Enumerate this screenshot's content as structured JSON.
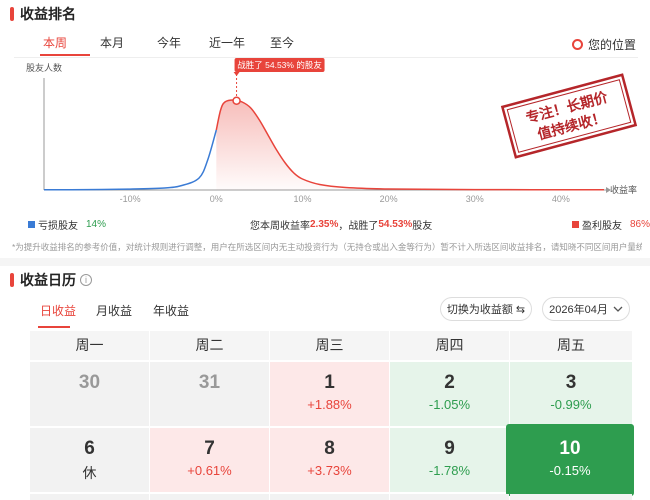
{
  "rank_section": {
    "title": "收益排名",
    "tabs": [
      "本周",
      "本月",
      "今年",
      "近一年",
      "至今"
    ],
    "active_tab": "本周",
    "my_position_label": "您的位置",
    "tooltip": "战胜了 54.53% 的股友",
    "y_axis_label": "股友人数",
    "x_axis_label": "收益率",
    "x_ticks": [
      "-10%",
      "0%",
      "10%",
      "20%",
      "30%",
      "40%"
    ],
    "stamp_line1": "专注！长期价",
    "stamp_line2": "值持续收！",
    "legend_loss_label": "亏损股友",
    "legend_loss_pct": "14%",
    "legend_profit_label": "盈利股友",
    "legend_profit_pct": "86%",
    "summary_prefix": "您本周收益率",
    "summary_rate": "2.35%",
    "summary_mid": "，战胜了",
    "summary_beat": "54.53%",
    "summary_suffix": "股友",
    "note": "*为提升收益排名的参考价值，对统计规则进行调整，用户在所选区间内无主动投资行为（无持仓或出入金等行为）暂不计入所选区间收益排名，请知晓不同区间用户量统计基数差异。",
    "colors": {
      "loss": "#3a7bd5",
      "profit": "#e8443b"
    }
  },
  "chart_data": {
    "type": "area",
    "xlabel": "收益率",
    "ylabel": "股友人数",
    "x_ticks": [
      "-10%",
      "0%",
      "10%",
      "20%",
      "30%",
      "40%"
    ],
    "xlim": [
      -20,
      45
    ],
    "series": [
      {
        "name": "亏损股友",
        "x": [
          -20,
          -15,
          -10,
          -6,
          -4,
          -2,
          -1,
          0
        ],
        "y": [
          0.2,
          0.4,
          0.9,
          2,
          4.5,
          12,
          30,
          60
        ]
      },
      {
        "name": "盈利股友",
        "x": [
          0,
          0.5,
          1,
          2,
          3,
          4,
          5,
          6,
          7,
          8,
          9,
          10,
          12,
          15,
          20,
          30,
          45
        ],
        "y": [
          60,
          80,
          88,
          90,
          88,
          82,
          70,
          55,
          40,
          27,
          17,
          11,
          5.5,
          2.5,
          1,
          0.4,
          0.2
        ]
      }
    ],
    "marker": {
      "x": 2.35,
      "label": "战胜了 54.53% 的股友"
    }
  },
  "calendar": {
    "title": "收益日历",
    "tabs": [
      "日收益",
      "月收益",
      "年收益"
    ],
    "active_tab": "日收益",
    "toggle_button": "切换为收益额 ⇆",
    "month_select": "2026年04月",
    "weekdays": [
      "周一",
      "周二",
      "周三",
      "周四",
      "周五"
    ],
    "rows": [
      [
        {
          "day": "30",
          "value": "",
          "state": "other"
        },
        {
          "day": "31",
          "value": "",
          "state": "other"
        },
        {
          "day": "1",
          "value": "+1.88%",
          "state": "up"
        },
        {
          "day": "2",
          "value": "-1.05%",
          "state": "down"
        },
        {
          "day": "3",
          "value": "-0.99%",
          "state": "down"
        }
      ],
      [
        {
          "day": "6",
          "value": "休",
          "state": "rest"
        },
        {
          "day": "7",
          "value": "+0.61%",
          "state": "up"
        },
        {
          "day": "8",
          "value": "+3.73%",
          "state": "up"
        },
        {
          "day": "9",
          "value": "-1.78%",
          "state": "down"
        },
        {
          "day": "10",
          "value": "-0.15%",
          "state": "selected"
        }
      ]
    ]
  }
}
